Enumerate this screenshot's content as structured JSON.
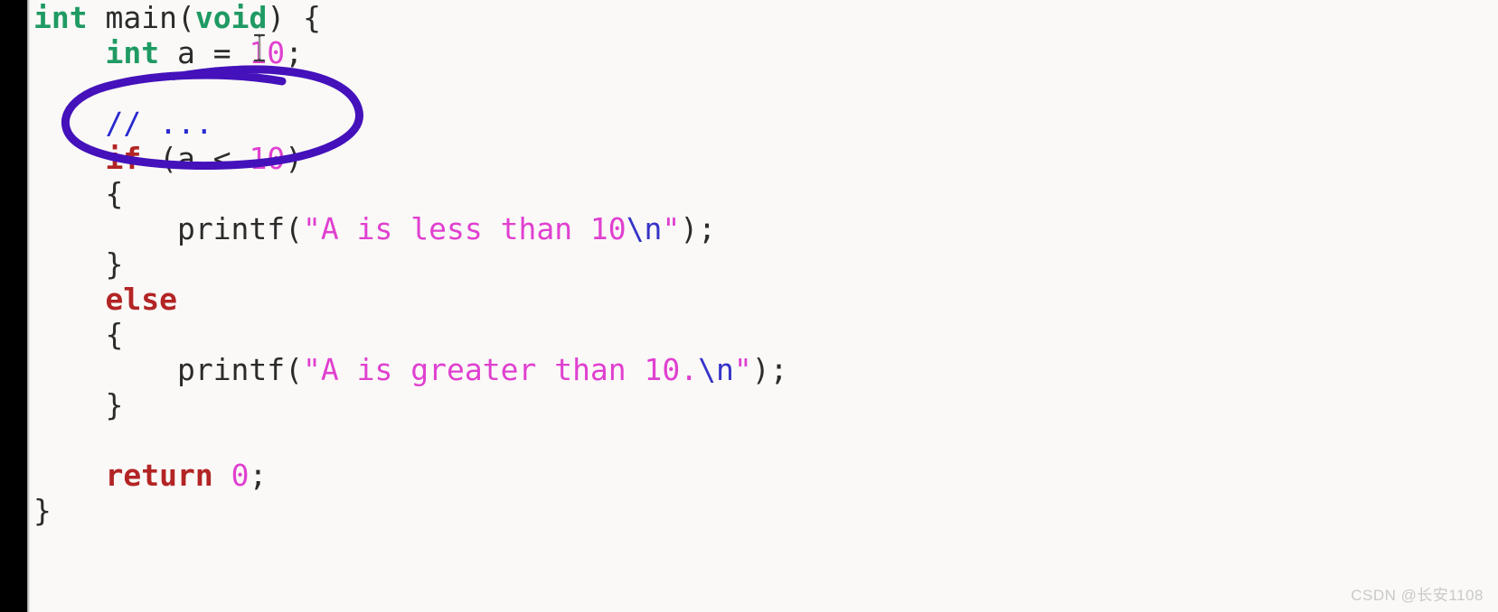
{
  "app": {
    "kind": "code-editor-screenshot",
    "background_color": "#faf9f7",
    "gutter_color": "#000000"
  },
  "code": {
    "language": "c",
    "lines": [
      {
        "n": 1,
        "text": "int main(void) {",
        "tokens": [
          {
            "t": "int",
            "c": "kw-type"
          },
          {
            "t": " ",
            "c": "plain"
          },
          {
            "t": "main",
            "c": "plain"
          },
          {
            "t": "(",
            "c": "punct"
          },
          {
            "t": "void",
            "c": "kw-type"
          },
          {
            "t": ")",
            "c": "punct"
          },
          {
            "t": " {",
            "c": "punct"
          }
        ]
      },
      {
        "n": 2,
        "text": "    int a = 10;",
        "tokens": [
          {
            "t": "    ",
            "c": "plain"
          },
          {
            "t": "int",
            "c": "kw-type"
          },
          {
            "t": " a = ",
            "c": "plain"
          },
          {
            "t": "10",
            "c": "num"
          },
          {
            "t": ";",
            "c": "punct"
          }
        ]
      },
      {
        "n": 3,
        "text": "",
        "tokens": []
      },
      {
        "n": 4,
        "text": "    // ...",
        "tokens": [
          {
            "t": "    ",
            "c": "plain"
          },
          {
            "t": "// ...",
            "c": "comment"
          }
        ]
      },
      {
        "n": 5,
        "text": "    if (a < 10)",
        "tokens": [
          {
            "t": "    ",
            "c": "plain"
          },
          {
            "t": "if",
            "c": "kw-ctrl"
          },
          {
            "t": " (a < ",
            "c": "plain"
          },
          {
            "t": "10",
            "c": "num"
          },
          {
            "t": ")",
            "c": "punct"
          }
        ]
      },
      {
        "n": 6,
        "text": "    {",
        "tokens": [
          {
            "t": "    {",
            "c": "punct"
          }
        ]
      },
      {
        "n": 7,
        "text": "        printf(\"A is less than 10\\n\");",
        "tokens": [
          {
            "t": "        ",
            "c": "plain"
          },
          {
            "t": "printf",
            "c": "plain"
          },
          {
            "t": "(",
            "c": "punct"
          },
          {
            "t": "\"",
            "c": "quote"
          },
          {
            "t": "A is less than 10",
            "c": "str"
          },
          {
            "t": "\\n",
            "c": "esc"
          },
          {
            "t": "\"",
            "c": "quote"
          },
          {
            "t": ");",
            "c": "punct"
          }
        ]
      },
      {
        "n": 8,
        "text": "    }",
        "tokens": [
          {
            "t": "    }",
            "c": "punct"
          }
        ]
      },
      {
        "n": 9,
        "text": "    else",
        "tokens": [
          {
            "t": "    ",
            "c": "plain"
          },
          {
            "t": "else",
            "c": "kw-ctrl"
          }
        ]
      },
      {
        "n": 10,
        "text": "    {",
        "tokens": [
          {
            "t": "    {",
            "c": "punct"
          }
        ]
      },
      {
        "n": 11,
        "text": "        printf(\"A is greater than 10.\\n\");",
        "tokens": [
          {
            "t": "        ",
            "c": "plain"
          },
          {
            "t": "printf",
            "c": "plain"
          },
          {
            "t": "(",
            "c": "punct"
          },
          {
            "t": "\"",
            "c": "quote"
          },
          {
            "t": "A is greater than 10.",
            "c": "str"
          },
          {
            "t": "\\n",
            "c": "esc"
          },
          {
            "t": "\"",
            "c": "quote"
          },
          {
            "t": ");",
            "c": "punct"
          }
        ]
      },
      {
        "n": 12,
        "text": "    }",
        "tokens": [
          {
            "t": "    }",
            "c": "punct"
          }
        ]
      },
      {
        "n": 13,
        "text": "",
        "tokens": []
      },
      {
        "n": 14,
        "text": "    return 0;",
        "tokens": [
          {
            "t": "    ",
            "c": "plain"
          },
          {
            "t": "return",
            "c": "kw-ctrl"
          },
          {
            "t": " ",
            "c": "plain"
          },
          {
            "t": "0",
            "c": "num"
          },
          {
            "t": ";",
            "c": "punct"
          }
        ]
      },
      {
        "n": 15,
        "text": "}",
        "tokens": [
          {
            "t": "}",
            "c": "punct"
          }
        ]
      }
    ]
  },
  "annotation": {
    "shape": "hand-drawn-ellipse",
    "color": "#4411bb",
    "stroke_width": 9,
    "encircles": "// ...  and  if (a < 10)"
  },
  "cursor": {
    "shape": "i-beam-text-cursor",
    "color": "#3b3b3b"
  },
  "colors": {
    "background": "#faf9f7",
    "gutter": "#000000",
    "keyword_type": "#1f9a63",
    "keyword_control": "#b32424",
    "number": "#e040d0",
    "string": "#e040d0",
    "escape": "#3633c8",
    "comment": "#2a2ad0",
    "plain_text": "#2b2b2b",
    "annotation_purple": "#4411bb",
    "watermark": "#c9c9c9"
  },
  "watermark": {
    "text": "CSDN @长安1108"
  }
}
